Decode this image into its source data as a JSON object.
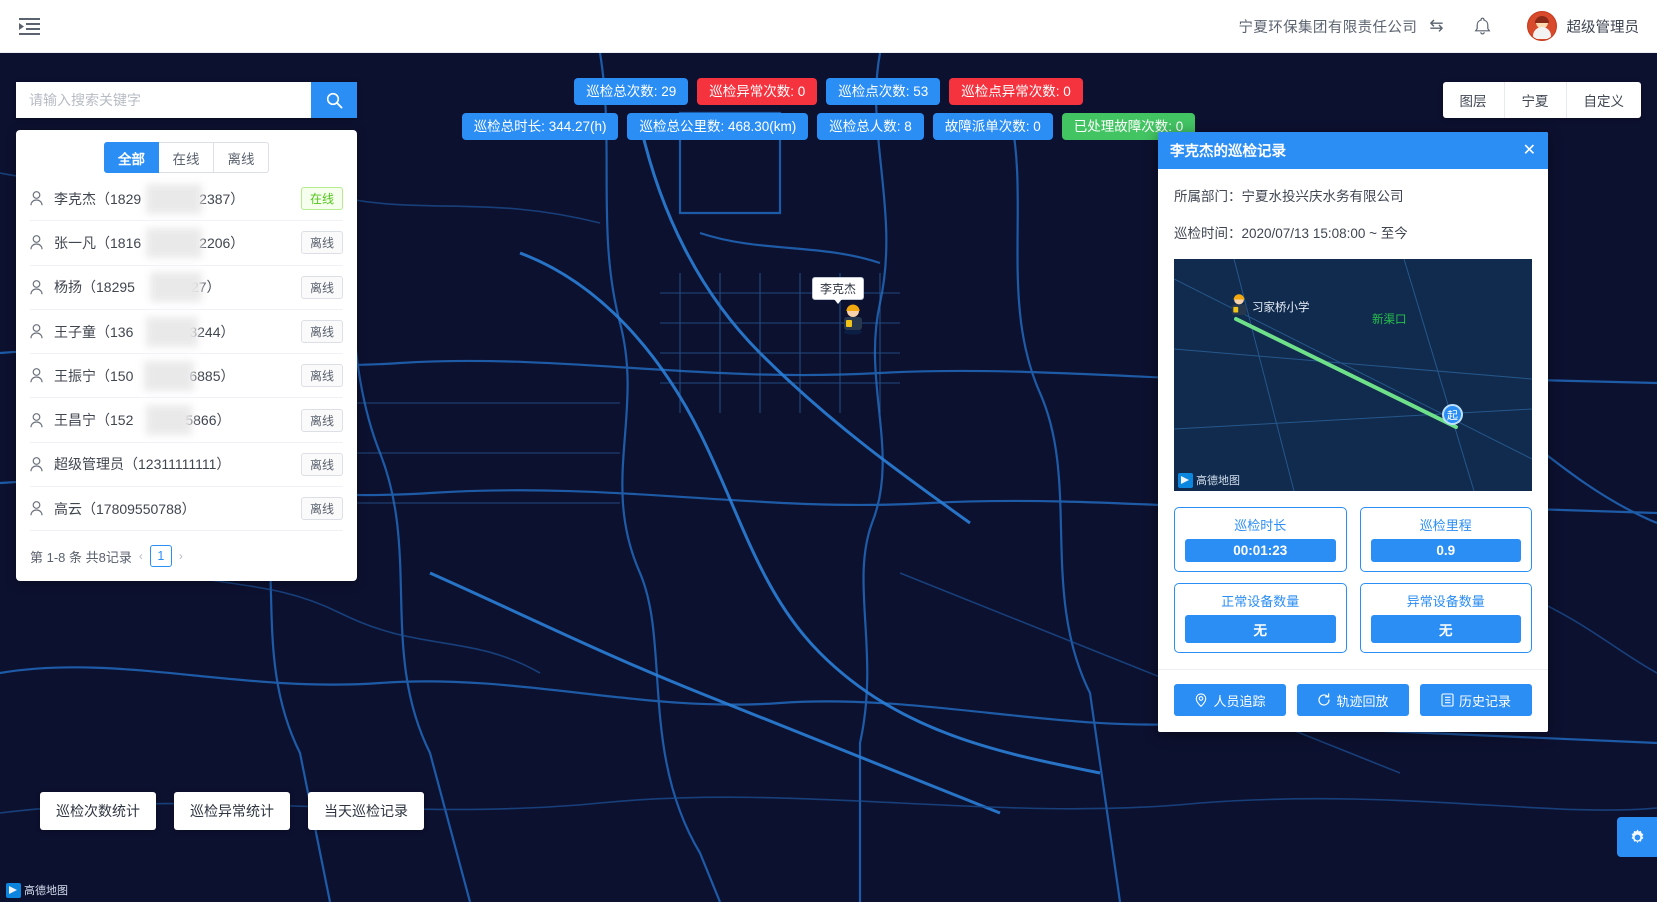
{
  "header": {
    "collapse_icon": "menu-fold-icon",
    "company": "宁夏环保集团有限责任公司",
    "swap_icon": "swap-icon",
    "bell_icon": "bell-icon",
    "username": "超级管理员"
  },
  "search": {
    "placeholder": "请输入搜索关键字",
    "value": "",
    "button_icon": "search-icon"
  },
  "stats": {
    "row1": [
      {
        "label": "巡检总次数: 29",
        "color": "#2b8ef5",
        "style": "blue"
      },
      {
        "label": "巡检异常次数: 0",
        "color": "#f5333f",
        "style": "red"
      },
      {
        "label": "巡检点次数: 53",
        "color": "#2b8ef5",
        "style": "blue"
      },
      {
        "label": "巡检点异常次数: 0",
        "color": "#f5333f",
        "style": "red"
      }
    ],
    "row2": [
      {
        "label": "巡检总时长: 344.27(h)",
        "color": "#2b8ef5",
        "style": "blue"
      },
      {
        "label": "巡检总公里数: 468.30(km)",
        "color": "#2b8ef5",
        "style": "blue"
      },
      {
        "label": "巡检总人数: 8",
        "color": "#2b8ef5",
        "style": "blue"
      },
      {
        "label": "故障派单次数: 0",
        "color": "#2b8ef5",
        "style": "blue"
      },
      {
        "label": "已处理故障次数: 0",
        "color": "#43c463",
        "style": "green"
      }
    ]
  },
  "user_panel": {
    "tabs": [
      {
        "label": "全部",
        "active": true
      },
      {
        "label": "在线",
        "active": false
      },
      {
        "label": "离线",
        "active": false
      }
    ],
    "users": [
      {
        "name": "李克杰（1829",
        "name_tail": "2387）",
        "status": "在线",
        "online": true
      },
      {
        "name": "张一凡（1816",
        "name_tail": "2206）",
        "status": "离线",
        "online": false
      },
      {
        "name": "杨扬（18295",
        "name_tail": "27）",
        "status": "离线",
        "online": false
      },
      {
        "name": "王子童（136",
        "name_tail": "3244）",
        "status": "离线",
        "online": false
      },
      {
        "name": "王振宁（150",
        "name_tail": "6885）",
        "status": "离线",
        "online": false
      },
      {
        "name": "王昌宁（152",
        "name_tail": "5866）",
        "status": "离线",
        "online": false
      },
      {
        "name": "超级管理员（12311111111）",
        "name_tail": "",
        "status": "离线",
        "online": false
      },
      {
        "name": "高云（17809550788）",
        "name_tail": "",
        "status": "离线",
        "online": false
      }
    ],
    "pagination": {
      "summary": "第 1-8 条 共8记录",
      "prev": "‹",
      "page": "1",
      "next": "›"
    }
  },
  "map_controls": [
    {
      "label": "图层"
    },
    {
      "label": "宁夏"
    },
    {
      "label": "自定义"
    }
  ],
  "map": {
    "marker_label": "李克杰",
    "logo_text": "高德地图"
  },
  "detail_panel": {
    "title": "李克杰的巡检记录",
    "close_icon": "close-icon",
    "department_label": "所属部门：",
    "department_value": "宁夏水投兴庆水务有限公司",
    "time_label": "巡检时间：",
    "time_value": "2020/07/13 15:08:00 ~ 至今",
    "mini_map": {
      "label_school": "习家桥小学",
      "label_canal": "新渠口",
      "start_marker": "起",
      "logo_text": "高德地图"
    },
    "cards": [
      {
        "label": "巡检时长",
        "value": "00:01:23"
      },
      {
        "label": "巡检里程",
        "value": "0.9"
      },
      {
        "label": "正常设备数量",
        "value": "无"
      },
      {
        "label": "异常设备数量",
        "value": "无"
      }
    ],
    "actions": [
      {
        "label": "人员追踪",
        "icon": "location-pin-icon"
      },
      {
        "label": "轨迹回放",
        "icon": "refresh-icon"
      },
      {
        "label": "历史记录",
        "icon": "list-icon"
      }
    ]
  },
  "bottom_buttons": [
    {
      "label": "巡检次数统计"
    },
    {
      "label": "巡检异常统计"
    },
    {
      "label": "当天巡检记录"
    }
  ],
  "fab": {
    "icon": "gear-icon"
  }
}
